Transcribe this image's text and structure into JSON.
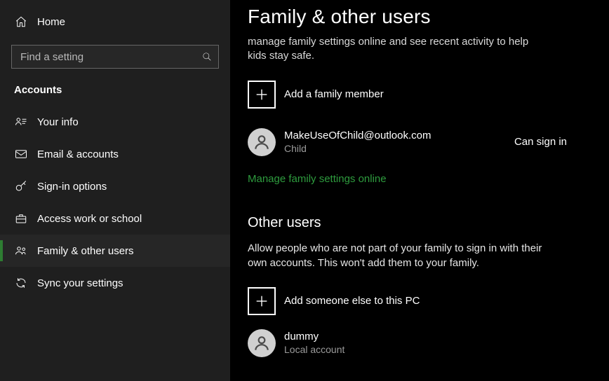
{
  "sidebar": {
    "home_label": "Home",
    "search_placeholder": "Find a setting",
    "category": "Accounts",
    "items": [
      {
        "label": "Your info"
      },
      {
        "label": "Email & accounts"
      },
      {
        "label": "Sign-in options"
      },
      {
        "label": "Access work or school"
      },
      {
        "label": "Family & other users"
      },
      {
        "label": "Sync your settings"
      }
    ]
  },
  "content": {
    "title": "Family & other users",
    "family_desc_tail": "manage family settings online and see recent activity to help kids stay safe.",
    "add_family_label": "Add a family member",
    "family_member": {
      "email": "MakeUseOfChild@outlook.com",
      "role": "Child",
      "status": "Can sign in"
    },
    "manage_link": "Manage family settings online",
    "other_users_header": "Other users",
    "other_users_desc": "Allow people who are not part of your family to sign in with their own accounts. This won't add them to your family.",
    "add_other_label": "Add someone else to this PC",
    "other_user": {
      "name": "dummy",
      "type": "Local account"
    }
  }
}
